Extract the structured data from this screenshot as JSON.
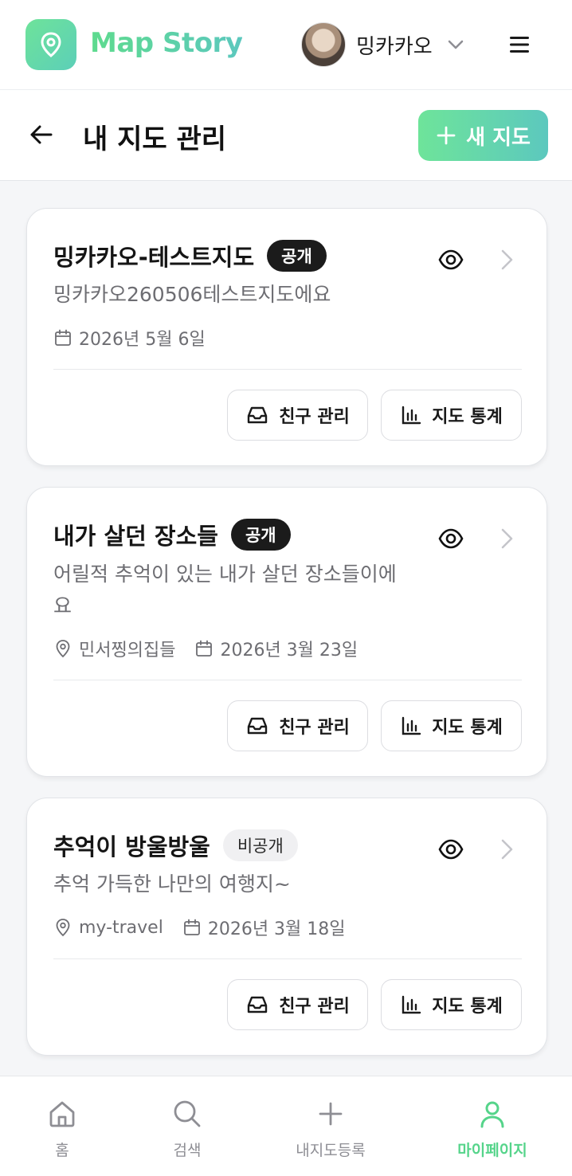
{
  "header": {
    "brand": "Map Story",
    "username": "밍카카오"
  },
  "subheader": {
    "title": "내 지도 관리",
    "new_map_label": "새 지도"
  },
  "maps": [
    {
      "title": "밍카카오-테스트지도",
      "visibility": "공개",
      "description": "밍카카오260506테스트지도에요",
      "location": "",
      "date": "2026년 5월 6일",
      "friends_label": "친구 관리",
      "stats_label": "지도 통계"
    },
    {
      "title": "내가 살던 장소들",
      "visibility": "공개",
      "description": "어릴적 추억이 있는 내가 살던 장소들이에요",
      "location": "민서찡의집들",
      "date": "2026년 3월 23일",
      "friends_label": "친구 관리",
      "stats_label": "지도 통계"
    },
    {
      "title": "추억이 방울방울",
      "visibility": "비공개",
      "description": "추억 가득한 나만의 여행지~",
      "location": "my-travel",
      "date": "2026년 3월 18일",
      "friends_label": "친구 관리",
      "stats_label": "지도 통계"
    }
  ],
  "bottom_nav": {
    "items": [
      {
        "label": "홈",
        "icon": "home-icon",
        "active": false
      },
      {
        "label": "검색",
        "icon": "search-icon",
        "active": false
      },
      {
        "label": "내지도등록",
        "icon": "plus-icon",
        "active": false
      },
      {
        "label": "마이페이지",
        "icon": "user-icon",
        "active": true
      }
    ]
  },
  "colors": {
    "accent_start": "#6ee49a",
    "accent_end": "#5cc8be",
    "active_nav": "#55d48a",
    "badge_public": "#1b1b1b",
    "badge_private": "#f0f0f2"
  }
}
